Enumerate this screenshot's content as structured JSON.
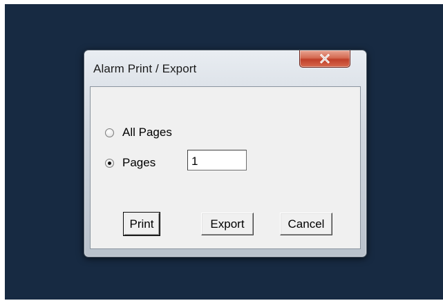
{
  "dialog": {
    "title": "Alarm Print / Export",
    "close_icon": "close-x-icon"
  },
  "options": {
    "all_pages_label": "All Pages",
    "all_pages_selected": false,
    "pages_label": "Pages",
    "pages_selected": true,
    "pages_value": "1"
  },
  "buttons": {
    "print_label": "Print",
    "export_label": "Export",
    "cancel_label": "Cancel"
  },
  "colors": {
    "desktop_background": "#172a42",
    "close_button": "#c8462f",
    "client_background": "#f0f0f0"
  }
}
